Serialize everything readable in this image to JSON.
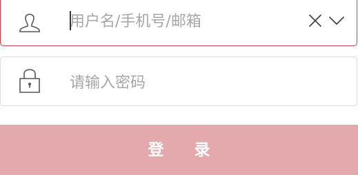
{
  "form": {
    "username": {
      "placeholder": "用户名/手机号/邮箱",
      "value": ""
    },
    "password": {
      "placeholder": "请输入密码",
      "value": ""
    },
    "login_label": "登 录"
  },
  "icons": {
    "user": "user-icon",
    "lock": "lock-icon",
    "clear": "close-icon",
    "dropdown": "chevron-down-icon"
  },
  "colors": {
    "active_border": "#c0404b",
    "inactive_border": "#dcdcdc",
    "button_bg": "#e3a9ac",
    "placeholder": "#a6a6a6"
  }
}
